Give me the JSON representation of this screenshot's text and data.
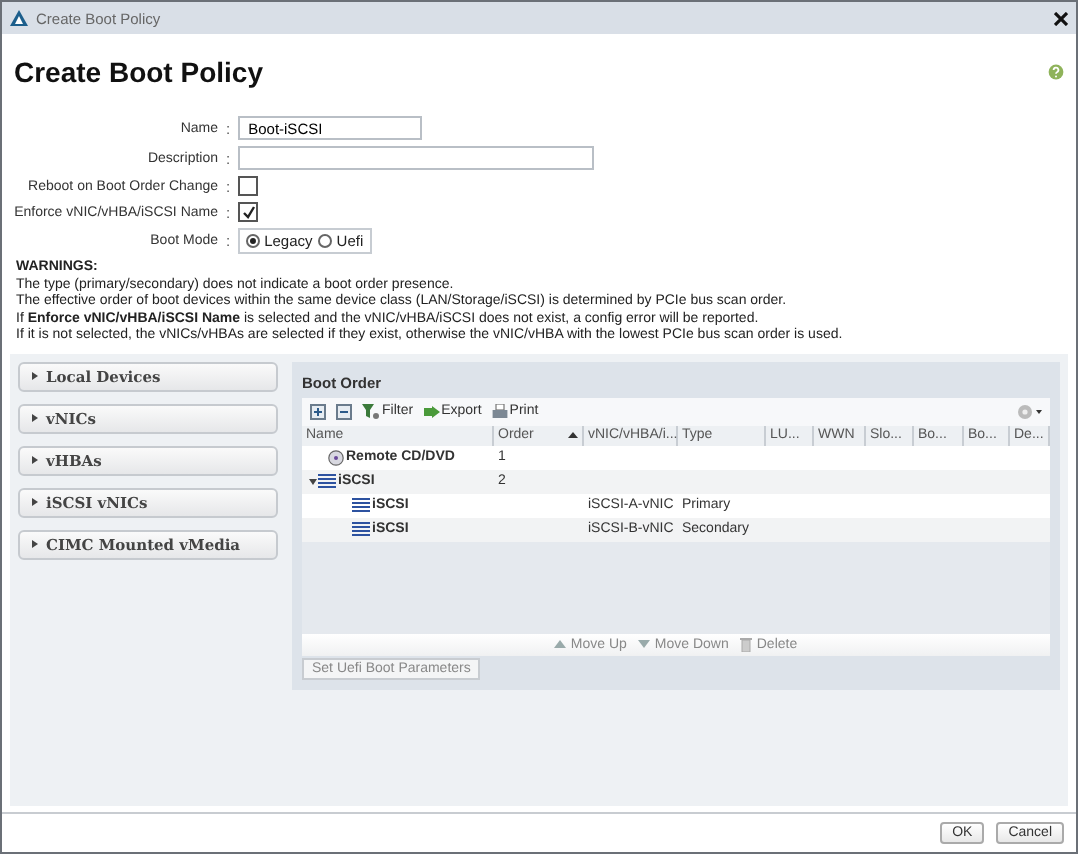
{
  "window": {
    "title": "Create Boot Policy"
  },
  "header": {
    "title": "Create Boot Policy"
  },
  "form": {
    "name": {
      "label": "Name",
      "separator": ":",
      "value": "Boot-iSCSI"
    },
    "description": {
      "label": "Description",
      "separator": ":"
    },
    "reboot": {
      "label": "Reboot on Boot Order Change",
      "separator": ":",
      "checked": false
    },
    "enforce": {
      "label": "Enforce vNIC/vHBA/iSCSI Name",
      "separator": ":",
      "checked": true
    },
    "boot_mode": {
      "label": "Boot Mode",
      "separator": ":",
      "options": [
        {
          "label": "Legacy",
          "selected": true
        },
        {
          "label": "Uefi",
          "selected": false
        }
      ]
    }
  },
  "warnings": {
    "heading": "WARNINGS:",
    "lines": [
      "The type (primary/secondary) does not indicate a boot order presence.",
      "The effective order of boot devices within the same device class (LAN/Storage/iSCSI) is determined by PCIe bus scan order.",
      "If **Enforce vNIC/vHBA/iSCSI Name** is selected and the vNIC/vHBA/iSCSI does not exist, a config error will be reported.",
      "If it is not selected, the vNICs/vHBAs are selected if they exist, otherwise the vNIC/vHBA with the lowest PCIe bus scan order is used."
    ]
  },
  "devices": [
    {
      "label": "Local Devices",
      "expanded": false
    },
    {
      "label": "vNICs",
      "expanded": false
    },
    {
      "label": "vHBAs",
      "expanded": false
    },
    {
      "label": "iSCSI vNICs",
      "expanded": false
    },
    {
      "label": "CIMC Mounted vMedia",
      "expanded": false
    }
  ],
  "boot_order": {
    "title": "Boot Order",
    "toolbar": [
      {
        "kind": "add"
      },
      {
        "kind": "remove"
      },
      {
        "kind": "filter",
        "label": "Filter"
      },
      {
        "kind": "export",
        "label": "Export"
      },
      {
        "kind": "print",
        "label": "Print"
      }
    ],
    "columns": [
      {
        "label": "Name",
        "sorted": false
      },
      {
        "label": "Order",
        "sorted": true
      },
      {
        "label": "vNIC/vHBA/i...",
        "sorted": false
      },
      {
        "label": "Type",
        "sorted": false
      },
      {
        "label": "LU...",
        "sorted": false
      },
      {
        "label": "WWN",
        "sorted": false
      },
      {
        "label": "Slo...",
        "sorted": false
      },
      {
        "label": "Bo...",
        "sorted": false
      },
      {
        "label": "Bo...",
        "sorted": false
      },
      {
        "label": "De...",
        "sorted": false
      }
    ],
    "rows": [
      {
        "kind": "cd",
        "name": "Remote CD/DVD",
        "order": "1"
      },
      {
        "kind": "iscsi",
        "name": "iSCSI",
        "order": "2",
        "expanded": true,
        "children": [
          {
            "kind": "iscsi",
            "name": "iSCSI",
            "vnic": "iSCSI-A-vNIC",
            "type": "Primary"
          },
          {
            "kind": "iscsi",
            "name": "iSCSI",
            "vnic": "iSCSI-B-vNIC",
            "type": "Secondary"
          }
        ]
      }
    ],
    "actions": [
      {
        "kind": "up",
        "label": "Move Up"
      },
      {
        "kind": "down",
        "label": "Move Down"
      },
      {
        "kind": "delete",
        "label": "Delete"
      }
    ],
    "uefi_button": "Set Uefi Boot Parameters"
  },
  "footer": {
    "buttons": [
      "OK",
      "Cancel"
    ]
  }
}
